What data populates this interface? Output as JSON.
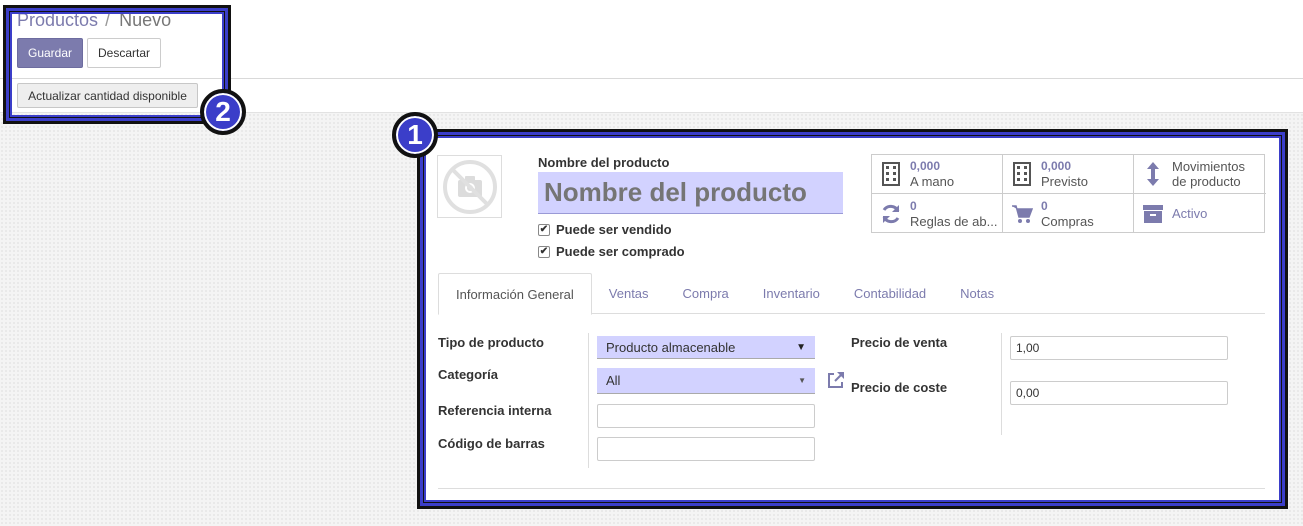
{
  "breadcrumb": {
    "parent": "Productos",
    "separator": "/",
    "current": "Nuevo"
  },
  "toolbar": {
    "save_label": "Guardar",
    "discard_label": "Descartar",
    "update_qty_label": "Actualizar cantidad disponible"
  },
  "annotations": {
    "badge1": "1",
    "badge2": "2"
  },
  "product": {
    "name_label": "Nombre del producto",
    "name_placeholder": "Nombre del producto",
    "can_be_sold_label": "Puede ser vendido",
    "can_be_purchased_label": "Puede ser comprado",
    "image_icon": "camera-off-icon"
  },
  "smart_buttons": [
    {
      "value": "0,000",
      "label": "A mano",
      "icon": "building-icon"
    },
    {
      "value": "0,000",
      "label": "Previsto",
      "icon": "building-icon"
    },
    {
      "value": "",
      "label": "Movimientos",
      "label2": "de producto",
      "icon": "up-down-arrow-icon"
    },
    {
      "value": "0",
      "label": "Reglas de ab...",
      "icon": "refresh-icon"
    },
    {
      "value": "0",
      "label": "Compras",
      "icon": "cart-icon"
    },
    {
      "value": "",
      "label": "Activo",
      "icon": "archive-icon"
    }
  ],
  "tabs": [
    "Información General",
    "Ventas",
    "Compra",
    "Inventario",
    "Contabilidad",
    "Notas"
  ],
  "general": {
    "product_type_label": "Tipo de producto",
    "product_type_value": "Producto almacenable",
    "category_label": "Categoría",
    "category_value": "All",
    "internal_ref_label": "Referencia interna",
    "barcode_label": "Código de barras",
    "sale_price_label": "Precio de venta",
    "sale_price_value": "1,00",
    "cost_label": "Precio de coste",
    "cost_value": "0,00"
  },
  "colors": {
    "accent": "#7c7bad",
    "highlight": "#3b3ec9",
    "required_bg": "#d2d2ff"
  }
}
